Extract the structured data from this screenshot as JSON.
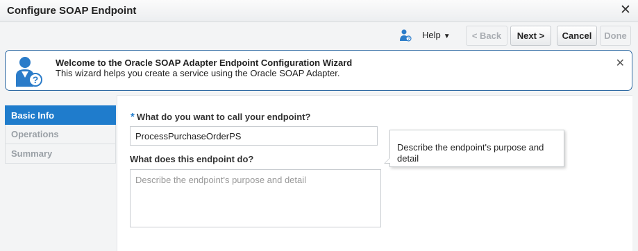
{
  "window": {
    "title": "Configure SOAP Endpoint",
    "close_icon": "close-icon"
  },
  "toolbar": {
    "help_label": "Help",
    "back_label": "< Back",
    "next_label": "Next >",
    "cancel_label": "Cancel",
    "done_label": "Done"
  },
  "banner": {
    "title": "Welcome to the Oracle SOAP Adapter Endpoint Configuration Wizard",
    "text": "This wizard helps you create a service using the Oracle SOAP Adapter.",
    "icon": "wizard-help-user-icon"
  },
  "nav": {
    "items": [
      {
        "label": "Basic Info",
        "active": true
      },
      {
        "label": "Operations",
        "active": false
      },
      {
        "label": "Summary",
        "active": false
      }
    ]
  },
  "form": {
    "required_marker": "*",
    "name_label": "What do you want to call your endpoint?",
    "name_value": "ProcessPurchaseOrderPS",
    "desc_label": "What does this endpoint do?",
    "desc_placeholder": "Describe the endpoint's purpose and detail",
    "tooltip_text": "Describe the endpoint's purpose and detail"
  },
  "colors": {
    "accent": "#1f7ccc",
    "banner_border": "#2f6aa3"
  }
}
